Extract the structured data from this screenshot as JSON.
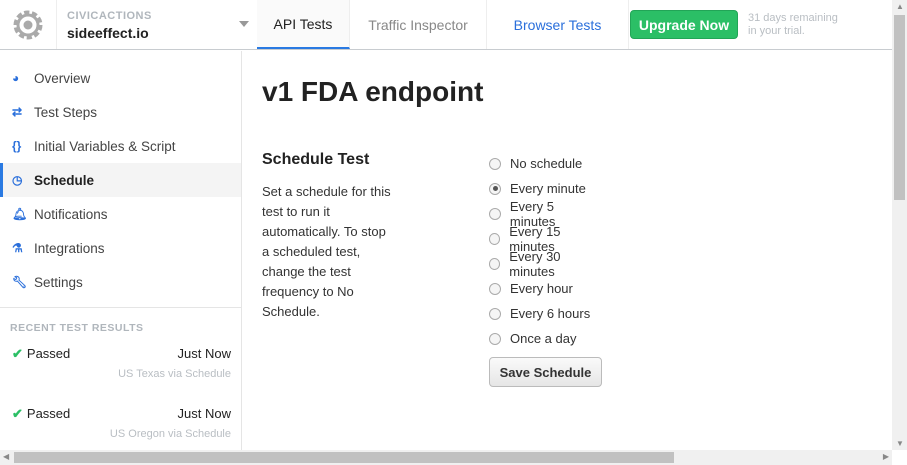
{
  "header": {
    "org": "CIVICACTIONS",
    "project": "sideeffect.io",
    "tabs": [
      "API Tests",
      "Traffic Inspector",
      "Browser Tests"
    ],
    "upgrade": "Upgrade Now",
    "trial_line1": "31 days remaining",
    "trial_line2": "in your trial."
  },
  "sidebar": {
    "items": [
      {
        "icon": "dashboard-icon",
        "label": "Overview"
      },
      {
        "icon": "exchange-icon",
        "label": "Test Steps"
      },
      {
        "icon": "braces-icon",
        "label": "Initial Variables & Script"
      },
      {
        "icon": "clock-icon",
        "label": "Schedule"
      },
      {
        "icon": "bell-icon",
        "label": "Notifications"
      },
      {
        "icon": "flask-icon",
        "label": "Integrations"
      },
      {
        "icon": "wrench-icon",
        "label": "Settings"
      }
    ],
    "recent_header": "RECENT TEST RESULTS",
    "results": [
      {
        "status": "Passed",
        "time": "Just Now",
        "location": "US Texas via Schedule"
      },
      {
        "status": "Passed",
        "time": "Just Now",
        "location": "US Oregon via Schedule"
      }
    ]
  },
  "main": {
    "title": "v1 FDA endpoint",
    "section": "Schedule Test",
    "description": "Set a schedule for this test to run it automatically. To stop a scheduled test, change the test frequency to No Schedule.",
    "options": [
      "No schedule",
      "Every minute",
      "Every 5 minutes",
      "Every 15 minutes",
      "Every 30 minutes",
      "Every hour",
      "Every 6 hours",
      "Once a day"
    ],
    "selected": "Every minute",
    "save": "Save Schedule"
  }
}
